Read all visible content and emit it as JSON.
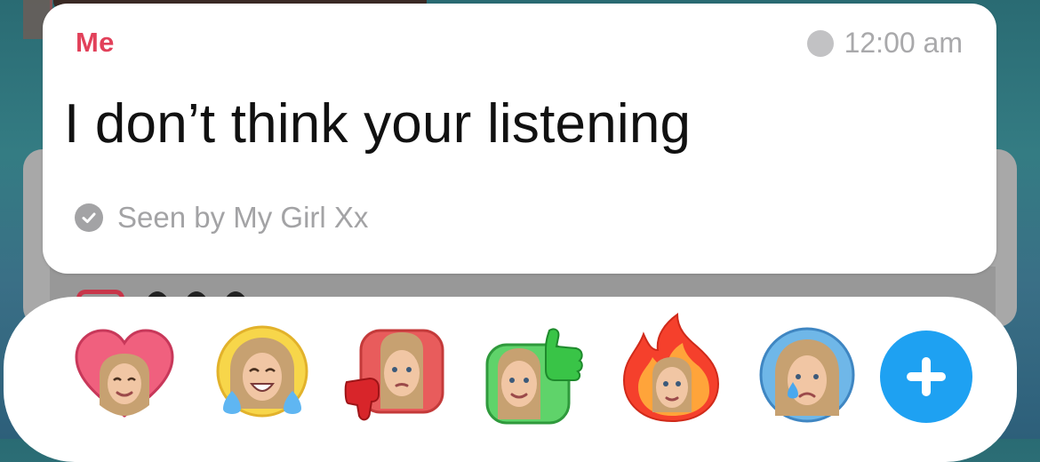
{
  "message": {
    "sender": "Me",
    "time": "12:00 am",
    "text": "I don’t think your listening",
    "seen_status": "Seen by My Girl Xx"
  },
  "reactions": [
    {
      "name": "heart",
      "icon": "heart-bitmoji-icon"
    },
    {
      "name": "laughing",
      "icon": "laughing-bitmoji-icon"
    },
    {
      "name": "thumbs-down",
      "icon": "thumbs-down-bitmoji-icon"
    },
    {
      "name": "thumbs-up",
      "icon": "thumbs-up-bitmoji-icon"
    },
    {
      "name": "fire",
      "icon": "fire-bitmoji-icon"
    },
    {
      "name": "crying",
      "icon": "crying-bitmoji-icon"
    }
  ],
  "add_reaction": {
    "icon": "plus-icon"
  },
  "colors": {
    "sender": "#e2415a",
    "accent_blue": "#1ea1f2",
    "muted_text": "#a3a3a5"
  }
}
